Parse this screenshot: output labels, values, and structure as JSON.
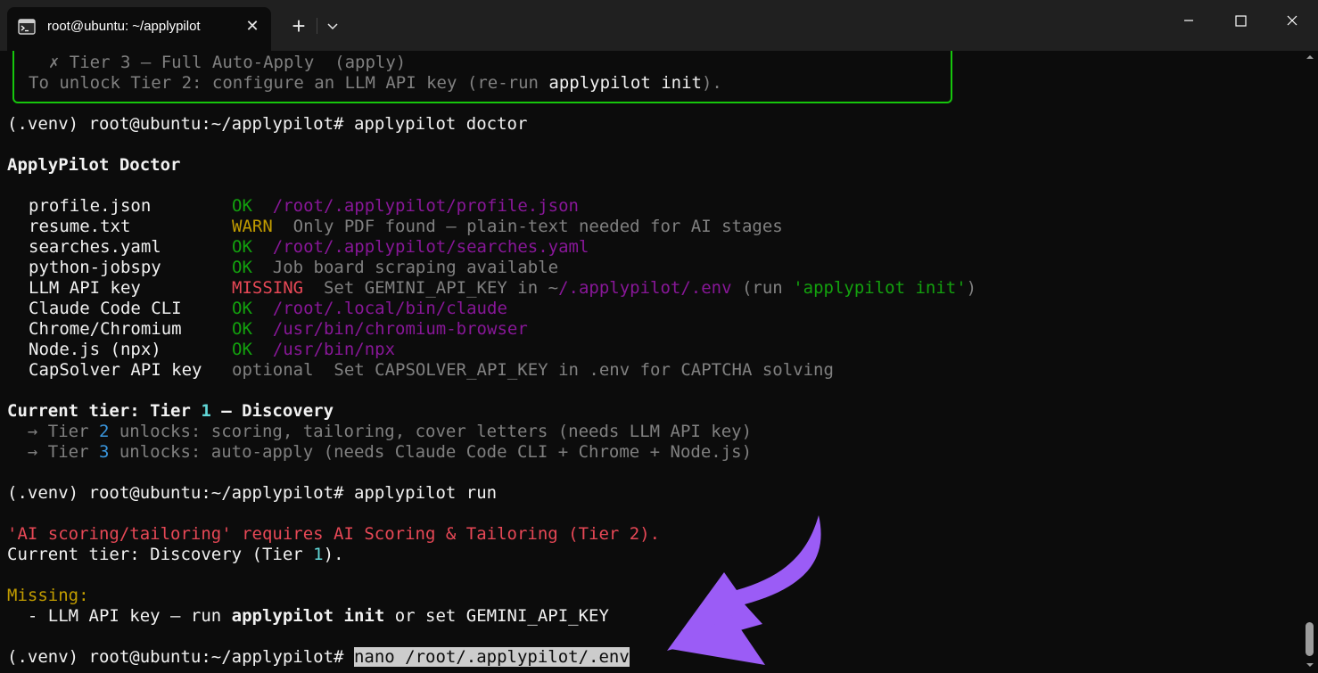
{
  "window": {
    "tab_title": "root@ubuntu: ~/applypilot",
    "tab_close": "✕",
    "new_tab": "+"
  },
  "terminal": {
    "tier3_prefix": "  ✗ Tier 3 — Full Auto-Apply  ",
    "tier3_cmd": "(apply)",
    "unlock_prefix": "To unlock Tier 2: configure an LLM API key (re-run ",
    "unlock_cmd": "applypilot init",
    "unlock_suffix": ").",
    "prompt": "(.venv) root@ubuntu:~/applypilot# ",
    "cmd_doctor": "applypilot doctor",
    "doctor_title": "ApplyPilot Doctor",
    "checks": [
      {
        "name": "profile.json",
        "status": "OK",
        "detail": "/root/.applypilot/profile.json"
      },
      {
        "name": "resume.txt",
        "status": "WARN",
        "detail": "Only PDF found — plain-text needed for AI stages"
      },
      {
        "name": "searches.yaml",
        "status": "OK",
        "detail": "/root/.applypilot/searches.yaml"
      },
      {
        "name": "python-jobspy",
        "status": "OK",
        "detail": "Job board scraping available"
      },
      {
        "name": "LLM API key",
        "status": "MISSING",
        "detail_a": "Set GEMINI_API_KEY in ~",
        "detail_b": "/.applypilot/.env",
        "detail_c": " (run ",
        "detail_d": "'applypilot init'",
        "detail_e": ")"
      },
      {
        "name": "Claude Code CLI",
        "status": "OK",
        "detail": "/root/.local/bin/claude"
      },
      {
        "name": "Chrome/Chromium",
        "status": "OK",
        "detail": "/usr/bin/chromium-browser"
      },
      {
        "name": "Node.js (npx)",
        "status": "OK",
        "detail": "/usr/bin/npx"
      },
      {
        "name": "CapSolver API key",
        "status": "optional",
        "detail": "Set CAPSOLVER_API_KEY in .env for CAPTCHA solving"
      }
    ],
    "tier_label": "Current tier: Tier ",
    "tier_num": "1",
    "tier_name": " — Discovery",
    "t2_prefix": "  → Tier ",
    "t2_num": "2",
    "t2_text": " unlocks: scoring, tailoring, cover letters (needs LLM API key)",
    "t3_prefix": "  → Tier ",
    "t3_num": "3",
    "t3_text": " unlocks: auto-apply (needs Claude Code CLI + Chrome + Node.js)",
    "cmd_run": "applypilot run",
    "err_text": "'AI scoring/tailoring' requires AI Scoring & Tailoring (",
    "err_tier": "Tier 2",
    "err_end": ").",
    "cur_prefix": "Current tier: Discovery (Tier ",
    "cur_num": "1",
    "cur_end": ").",
    "missing_label": "Missing:",
    "missing_prefix": "  - LLM API key — run ",
    "missing_cmd": "applypilot init",
    "missing_suffix": " or set GEMINI_API_KEY",
    "current_input": "nano /root/.applypilot/.env"
  },
  "colors": {
    "ok": "#13a10e",
    "warn": "#c19c00",
    "missing": "#e74856",
    "path": "#881798",
    "arrow": "#9b5cf6",
    "panel_border": "#16c60c"
  }
}
